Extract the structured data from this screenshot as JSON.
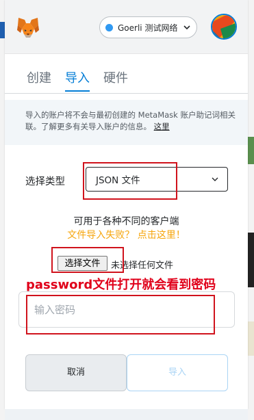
{
  "header": {
    "network_label": "Goerli 测试网络",
    "network_dot_color": "#3099f2",
    "logo_icon": "metamask-fox-icon",
    "account_icon": "account-avatar-icon"
  },
  "tabs": [
    {
      "label": "创建",
      "active": false
    },
    {
      "label": "导入",
      "active": true
    },
    {
      "label": "硬件",
      "active": false
    }
  ],
  "notice": {
    "text": "导入的账户将不会与最初创建的 MetaMask 账户助记词相关联。了解更多有关导入账户的信息。",
    "link": "这里"
  },
  "form": {
    "type_label": "选择类型",
    "type_value": "JSON 文件",
    "supported_text": "可用于各种不同的客户端",
    "failed_link": "文件导入失败？ 点击这里！",
    "file_button": "选择文件",
    "file_status": "未选择任何文件",
    "password_placeholder": "输入密码"
  },
  "annotation": {
    "text": "password文件打开就会看到密码",
    "color": "#e0001a"
  },
  "buttons": {
    "cancel": "取消",
    "import": "导入"
  },
  "colors": {
    "accent": "#037dd6",
    "warning_link": "#f6a50b",
    "annotation_box": "#d0121c"
  }
}
